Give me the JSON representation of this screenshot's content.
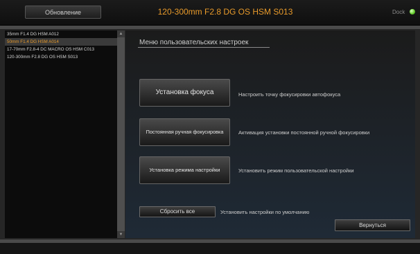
{
  "topbar": {
    "update_label": "Обновление",
    "lens_title": "120-300mm F2.8 DG OS HSM S013",
    "dock_label": "Dock"
  },
  "sidebar": {
    "items": [
      {
        "label": "35mm F1.4 DG HSM A012",
        "selected": false
      },
      {
        "label": "50mm F1.4 DG HSM A014",
        "selected": true
      },
      {
        "label": "17-70mm F2.8-4 DC MACRO OS HSM C013",
        "selected": false
      },
      {
        "label": "120-300mm F2.8 DG OS HSM S013",
        "selected": false
      }
    ]
  },
  "main": {
    "title": "Меню пользовательских настроек",
    "focus_setting": {
      "label": "Установка фокуса",
      "desc": "Настроить точку фокусировки автофокуса"
    },
    "manual_focus": {
      "label": "Постоянная ручная фокусировка",
      "desc": "Активация установки постоянной ручной фокусировки"
    },
    "mode_setting": {
      "label": "Установка режима настройки",
      "desc": "Установить режим пользовательской настройки"
    },
    "reset": {
      "label": "Сбросить все",
      "desc": "Установить настройки по умолчанию"
    },
    "back_label": "Вернуться"
  },
  "colors": {
    "accent": "#e89a2a",
    "led": "#6ad030"
  }
}
